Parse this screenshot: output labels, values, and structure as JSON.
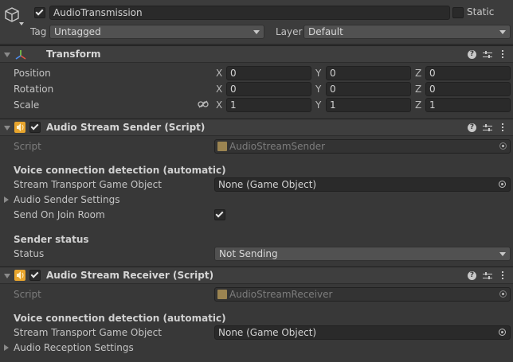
{
  "header": {
    "object_name": "AudioTransmission",
    "static_label": "Static",
    "tag_label": "Tag",
    "tag_value": "Untagged",
    "layer_label": "Layer",
    "layer_value": "Default"
  },
  "transform": {
    "title": "Transform",
    "position_label": "Position",
    "rotation_label": "Rotation",
    "scale_label": "Scale",
    "axis_x": "X",
    "axis_y": "Y",
    "axis_z": "Z",
    "position": {
      "x": "0",
      "y": "0",
      "z": "0"
    },
    "rotation": {
      "x": "0",
      "y": "0",
      "z": "0"
    },
    "scale": {
      "x": "1",
      "y": "1",
      "z": "1"
    }
  },
  "sender": {
    "title": "Audio Stream Sender (Script)",
    "script_label": "Script",
    "script_value": "AudioStreamSender",
    "section_voice": "Voice connection detection (automatic)",
    "stream_transport_label": "Stream Transport Game Object",
    "stream_transport_value": "None (Game Object)",
    "settings_label": "Audio Sender Settings",
    "send_on_join_label": "Send On Join Room",
    "status_section": "Sender status",
    "status_label": "Status",
    "status_value": "Not Sending"
  },
  "receiver": {
    "title": "Audio Stream Receiver (Script)",
    "script_label": "Script",
    "script_value": "AudioStreamReceiver",
    "section_voice": "Voice connection detection (automatic)",
    "stream_transport_label": "Stream Transport Game Object",
    "stream_transport_value": "None (Game Object)",
    "settings_label": "Audio Reception Settings"
  },
  "icons": {
    "help": "?",
    "accent_audio": "#e8a52d"
  }
}
